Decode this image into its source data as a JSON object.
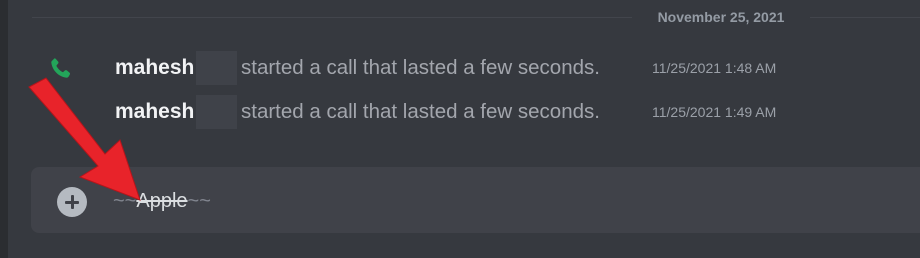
{
  "date_divider": "November 25, 2021",
  "messages": [
    {
      "author": "mahesh",
      "text": "started a call that lasted a few seconds.",
      "timestamp": "11/25/2021 1:48 AM"
    },
    {
      "author": "mahesh",
      "text": "started a call that lasted a few seconds.",
      "timestamp": "11/25/2021 1:49 AM"
    }
  ],
  "composer": {
    "prefix": "~~",
    "value": "Apple",
    "suffix": "~~"
  },
  "icons": {
    "call": "phone-icon",
    "upload": "plus-circle-icon",
    "annotation": "red-arrow"
  },
  "colors": {
    "background": "#36393f",
    "composer_bg": "#404249",
    "call_icon": "#23a55a",
    "arrow": "#e8232a"
  }
}
